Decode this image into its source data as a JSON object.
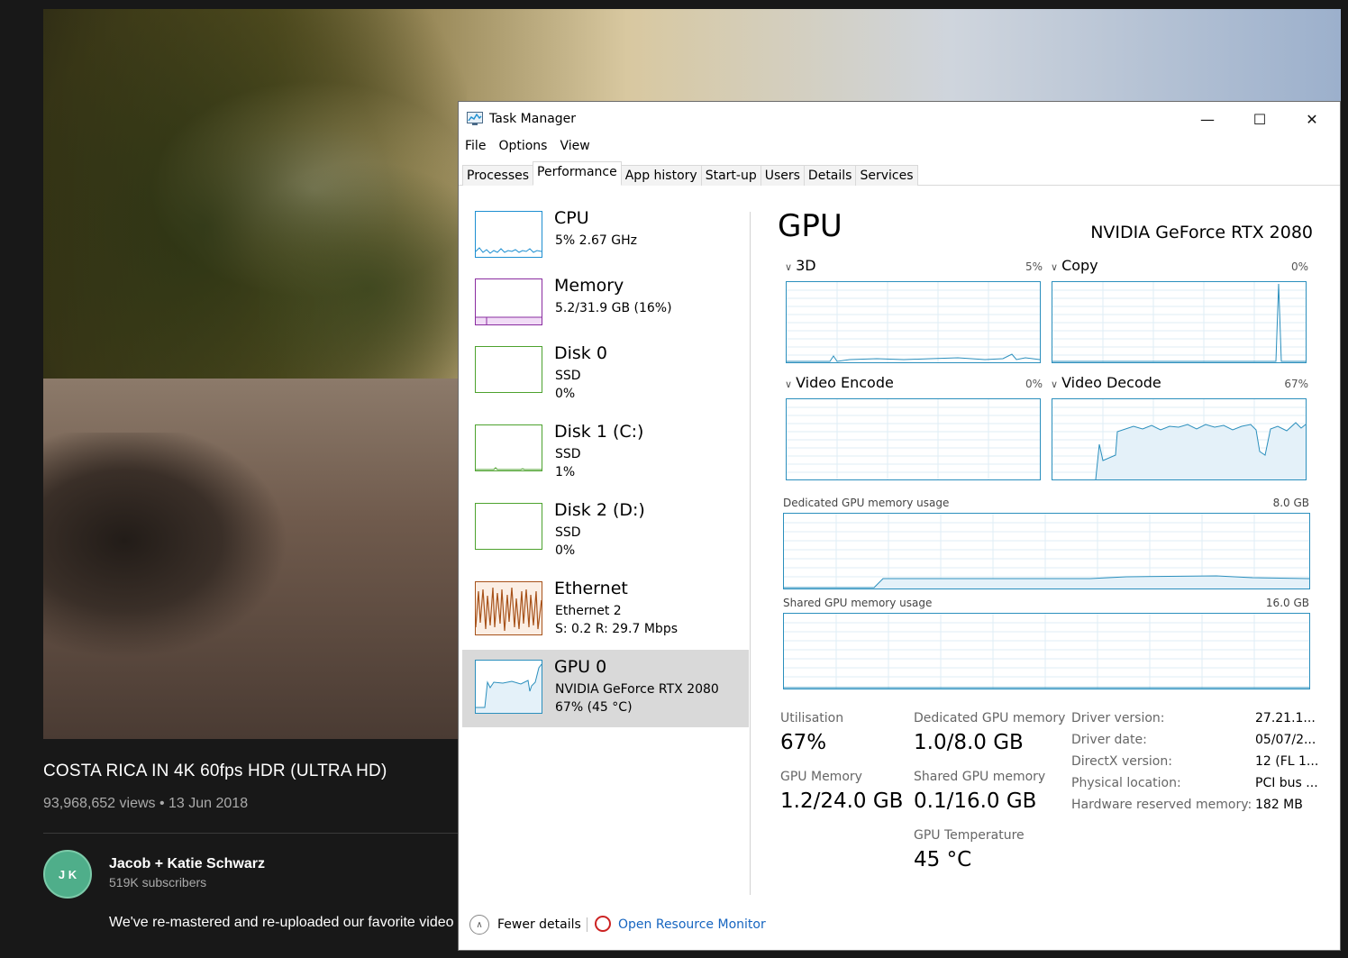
{
  "youtube": {
    "title": "COSTA RICA IN 4K 60fps HDR (ULTRA HD)",
    "meta": "93,968,652 views • 13 Jun 2018",
    "channel": "Jacob + Katie Schwarz",
    "subscribers": "519K subscribers",
    "description": "We've re-mastered and re-uploaded our favorite video in",
    "avatar_text": "J K"
  },
  "window": {
    "title": "Task Manager",
    "minimize": "—",
    "maximize": "☐",
    "close": "✕"
  },
  "menu": [
    "File",
    "Options",
    "View"
  ],
  "tabs": [
    {
      "label": "Processes",
      "active": false
    },
    {
      "label": "Performance",
      "active": true
    },
    {
      "label": "App history",
      "active": false
    },
    {
      "label": "Start-up",
      "active": false
    },
    {
      "label": "Users",
      "active": false
    },
    {
      "label": "Details",
      "active": false
    },
    {
      "label": "Services",
      "active": false
    }
  ],
  "resources": [
    {
      "name": "CPU",
      "lines": [
        "5% 2.67 GHz"
      ],
      "color": "#1d8fd1"
    },
    {
      "name": "Memory",
      "lines": [
        "5.2/31.9 GB (16%)"
      ],
      "color": "#8a2ca0"
    },
    {
      "name": "Disk 0",
      "lines": [
        "SSD",
        "0%"
      ],
      "color": "#4da22e"
    },
    {
      "name": "Disk 1 (C:)",
      "lines": [
        "SSD",
        "1%"
      ],
      "color": "#4da22e"
    },
    {
      "name": "Disk 2 (D:)",
      "lines": [
        "SSD",
        "0%"
      ],
      "color": "#4da22e"
    },
    {
      "name": "Ethernet",
      "lines": [
        "Ethernet 2",
        "S: 0.2  R: 29.7 Mbps"
      ],
      "color": "#a7521a"
    },
    {
      "name": "GPU 0",
      "lines": [
        "NVIDIA GeForce RTX 2080",
        "67% (45 °C)"
      ],
      "color": "#2b8fbd",
      "selected": true
    }
  ],
  "gpu": {
    "heading": "GPU",
    "model": "NVIDIA GeForce RTX 2080",
    "engines": [
      {
        "label": "3D",
        "pct": "5%"
      },
      {
        "label": "Copy",
        "pct": "0%"
      },
      {
        "label": "Video Encode",
        "pct": "0%"
      },
      {
        "label": "Video Decode",
        "pct": "67%"
      }
    ],
    "dedicated_label": "Dedicated GPU memory usage",
    "dedicated_max": "8.0 GB",
    "shared_label": "Shared GPU memory usage",
    "shared_max": "16.0 GB",
    "stats": {
      "utilisation_label": "Utilisation",
      "utilisation": "67%",
      "gpu_memory_label": "GPU Memory",
      "gpu_memory": "1.2/24.0 GB",
      "dedicated_label": "Dedicated GPU memory",
      "dedicated": "1.0/8.0 GB",
      "shared_label": "Shared GPU memory",
      "shared": "0.1/16.0 GB",
      "temp_label": "GPU Temperature",
      "temp": "45 °C"
    },
    "driver": [
      {
        "label": "Driver version:",
        "value": "27.21.1..."
      },
      {
        "label": "Driver date:",
        "value": "05/07/2..."
      },
      {
        "label": "DirectX version:",
        "value": "12 (FL 1..."
      },
      {
        "label": "Physical location:",
        "value": "PCI bus ..."
      },
      {
        "label": "Hardware reserved memory:",
        "value": "182 MB"
      }
    ]
  },
  "footer": {
    "fewer": "Fewer details",
    "monitor": "Open Resource Monitor"
  }
}
